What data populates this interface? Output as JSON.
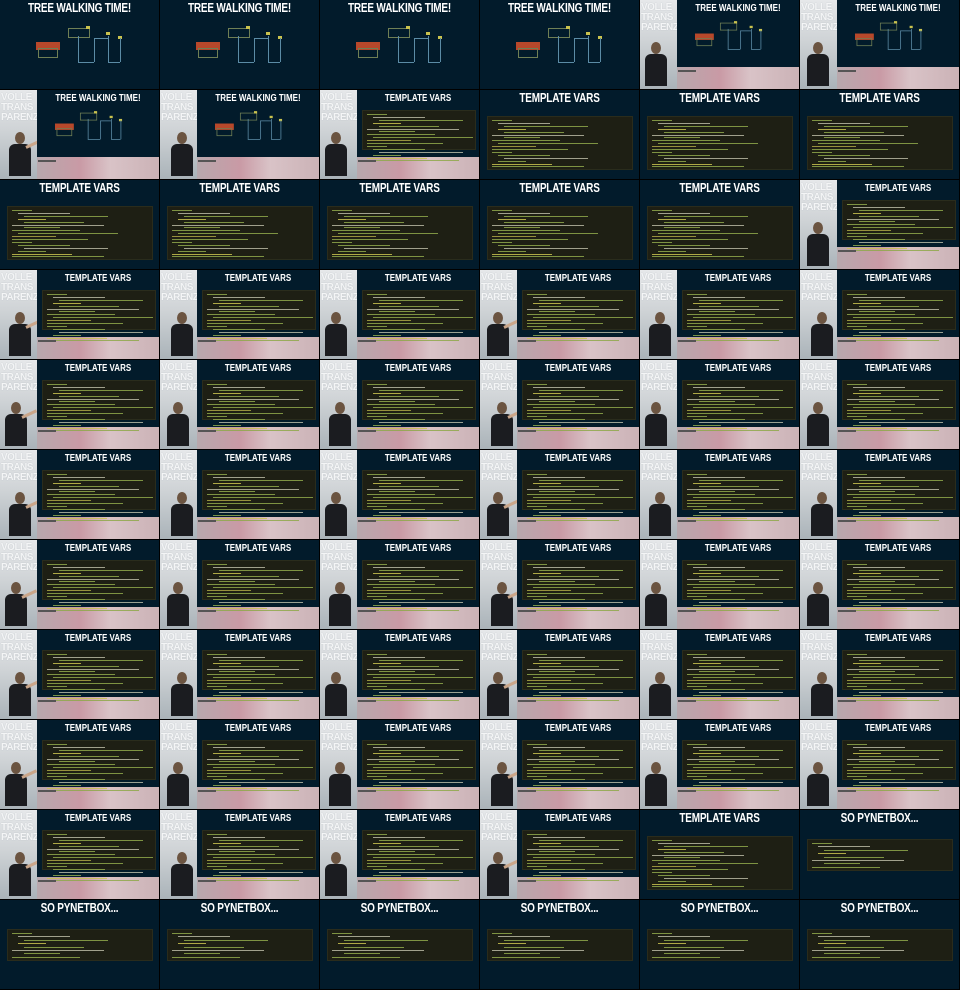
{
  "slides": [
    {
      "layout": "full",
      "kind": "tree",
      "title": "TREE WALKING TIME!"
    },
    {
      "layout": "full",
      "kind": "tree",
      "title": "TREE WALKING TIME!"
    },
    {
      "layout": "full",
      "kind": "tree",
      "title": "TREE WALKING TIME!"
    },
    {
      "layout": "full",
      "kind": "tree",
      "title": "TREE WALKING TIME!"
    },
    {
      "layout": "speaker",
      "kind": "tree",
      "title": "TREE WALKING TIME!",
      "brand": "VOLLE\nTRANS\nPARENZ"
    },
    {
      "layout": "speaker",
      "kind": "tree",
      "title": "TREE WALKING TIME!",
      "brand": "VOLLE\nTRANS\nPARENZ"
    },
    {
      "layout": "speaker",
      "kind": "tree",
      "title": "TREE WALKING TIME!",
      "brand": "VOLLE\nTRANS\nPARENZ"
    },
    {
      "layout": "speaker",
      "kind": "tree",
      "title": "TREE WALKING TIME!",
      "brand": "VOLLE\nTRANS\nPARENZ"
    },
    {
      "layout": "speaker",
      "kind": "template",
      "title": "TEMPLATE VARS",
      "brand": "VOLLE\nTRANS\nPARENZ"
    },
    {
      "layout": "full",
      "kind": "template",
      "title": "TEMPLATE VARS"
    },
    {
      "layout": "full",
      "kind": "template",
      "title": "TEMPLATE VARS"
    },
    {
      "layout": "full",
      "kind": "template",
      "title": "TEMPLATE VARS"
    },
    {
      "layout": "full",
      "kind": "template",
      "title": "TEMPLATE VARS"
    },
    {
      "layout": "full",
      "kind": "template",
      "title": "TEMPLATE VARS"
    },
    {
      "layout": "full",
      "kind": "template",
      "title": "TEMPLATE VARS"
    },
    {
      "layout": "full",
      "kind": "template",
      "title": "TEMPLATE VARS"
    },
    {
      "layout": "full",
      "kind": "template",
      "title": "TEMPLATE VARS"
    },
    {
      "layout": "speaker",
      "kind": "template",
      "title": "TEMPLATE VARS",
      "brand": "VOLLE\nTRANS\nPARENZ"
    },
    {
      "layout": "speaker",
      "kind": "template",
      "title": "TEMPLATE VARS",
      "brand": "VOLLE\nTRANS\nPARENZ"
    },
    {
      "layout": "speaker",
      "kind": "template",
      "title": "TEMPLATE VARS",
      "brand": "VOLLE\nTRANS\nPARENZ"
    },
    {
      "layout": "speaker",
      "kind": "template",
      "title": "TEMPLATE VARS",
      "brand": "VOLLE\nTRANS\nPARENZ"
    },
    {
      "layout": "speaker",
      "kind": "template",
      "title": "TEMPLATE VARS",
      "brand": "VOLLE\nTRANS\nPARENZ"
    },
    {
      "layout": "speaker",
      "kind": "template",
      "title": "TEMPLATE VARS",
      "brand": "VOLLE\nTRANS\nPARENZ"
    },
    {
      "layout": "speaker",
      "kind": "template",
      "title": "TEMPLATE VARS",
      "brand": "VOLLE\nTRANS\nPARENZ"
    },
    {
      "layout": "speaker",
      "kind": "template",
      "title": "TEMPLATE VARS",
      "brand": "VOLLE\nTRANS\nPARENZ"
    },
    {
      "layout": "speaker",
      "kind": "template",
      "title": "TEMPLATE VARS",
      "brand": "VOLLE\nTRANS\nPARENZ"
    },
    {
      "layout": "speaker",
      "kind": "template",
      "title": "TEMPLATE VARS",
      "brand": "VOLLE\nTRANS\nPARENZ"
    },
    {
      "layout": "speaker",
      "kind": "template",
      "title": "TEMPLATE VARS",
      "brand": "VOLLE\nTRANS\nPARENZ"
    },
    {
      "layout": "speaker",
      "kind": "template",
      "title": "TEMPLATE VARS",
      "brand": "VOLLE\nTRANS\nPARENZ"
    },
    {
      "layout": "speaker",
      "kind": "template",
      "title": "TEMPLATE VARS",
      "brand": "VOLLE\nTRANS\nPARENZ"
    },
    {
      "layout": "speaker",
      "kind": "template",
      "title": "TEMPLATE VARS",
      "brand": "VOLLE\nTRANS\nPARENZ"
    },
    {
      "layout": "speaker",
      "kind": "template",
      "title": "TEMPLATE VARS",
      "brand": "VOLLE\nTRANS\nPARENZ"
    },
    {
      "layout": "speaker",
      "kind": "template",
      "title": "TEMPLATE VARS",
      "brand": "VOLLE\nTRANS\nPARENZ"
    },
    {
      "layout": "speaker",
      "kind": "template",
      "title": "TEMPLATE VARS",
      "brand": "VOLLE\nTRANS\nPARENZ"
    },
    {
      "layout": "speaker",
      "kind": "template",
      "title": "TEMPLATE VARS",
      "brand": "VOLLE\nTRANS\nPARENZ"
    },
    {
      "layout": "speaker",
      "kind": "template",
      "title": "TEMPLATE VARS",
      "brand": "VOLLE\nTRANS\nPARENZ"
    },
    {
      "layout": "speaker",
      "kind": "template",
      "title": "TEMPLATE VARS",
      "brand": "VOLLE\nTRANS\nPARENZ"
    },
    {
      "layout": "speaker",
      "kind": "template",
      "title": "TEMPLATE VARS",
      "brand": "VOLLE\nTRANS\nPARENZ"
    },
    {
      "layout": "speaker",
      "kind": "template",
      "title": "TEMPLATE VARS",
      "brand": "VOLLE\nTRANS\nPARENZ"
    },
    {
      "layout": "speaker",
      "kind": "template",
      "title": "TEMPLATE VARS",
      "brand": "VOLLE\nTRANS\nPARENZ"
    },
    {
      "layout": "speaker",
      "kind": "template",
      "title": "TEMPLATE VARS",
      "brand": "VOLLE\nTRANS\nPARENZ"
    },
    {
      "layout": "speaker",
      "kind": "template",
      "title": "TEMPLATE VARS",
      "brand": "VOLLE\nTRANS\nPARENZ"
    },
    {
      "layout": "speaker",
      "kind": "template",
      "title": "TEMPLATE VARS",
      "brand": "VOLLE\nTRANS\nPARENZ"
    },
    {
      "layout": "speaker",
      "kind": "template",
      "title": "TEMPLATE VARS",
      "brand": "VOLLE\nTRANS\nPARENZ"
    },
    {
      "layout": "speaker",
      "kind": "template",
      "title": "TEMPLATE VARS",
      "brand": "VOLLE\nTRANS\nPARENZ"
    },
    {
      "layout": "speaker",
      "kind": "template",
      "title": "TEMPLATE VARS",
      "brand": "VOLLE\nTRANS\nPARENZ"
    },
    {
      "layout": "speaker",
      "kind": "template",
      "title": "TEMPLATE VARS",
      "brand": "VOLLE\nTRANS\nPARENZ"
    },
    {
      "layout": "speaker",
      "kind": "template",
      "title": "TEMPLATE VARS",
      "brand": "VOLLE\nTRANS\nPARENZ"
    },
    {
      "layout": "speaker",
      "kind": "template",
      "title": "TEMPLATE VARS",
      "brand": "VOLLE\nTRANS\nPARENZ"
    },
    {
      "layout": "speaker",
      "kind": "template",
      "title": "TEMPLATE VARS",
      "brand": "VOLLE\nTRANS\nPARENZ"
    },
    {
      "layout": "speaker",
      "kind": "template",
      "title": "TEMPLATE VARS",
      "brand": "VOLLE\nTRANS\nPARENZ"
    },
    {
      "layout": "speaker",
      "kind": "template",
      "title": "TEMPLATE VARS",
      "brand": "VOLLE\nTRANS\nPARENZ"
    },
    {
      "layout": "speaker",
      "kind": "template",
      "title": "TEMPLATE VARS",
      "brand": "VOLLE\nTRANS\nPARENZ"
    },
    {
      "layout": "speaker",
      "kind": "template",
      "title": "TEMPLATE VARS",
      "brand": "VOLLE\nTRANS\nPARENZ"
    },
    {
      "layout": "speaker",
      "kind": "template",
      "title": "TEMPLATE VARS",
      "brand": "VOLLE\nTRANS\nPARENZ"
    },
    {
      "layout": "speaker",
      "kind": "template",
      "title": "TEMPLATE VARS",
      "brand": "VOLLE\nTRANS\nPARENZ"
    },
    {
      "layout": "speaker",
      "kind": "template",
      "title": "TEMPLATE VARS",
      "brand": "VOLLE\nTRANS\nPARENZ"
    },
    {
      "layout": "speaker",
      "kind": "template",
      "title": "TEMPLATE VARS",
      "brand": "VOLLE\nTRANS\nPARENZ"
    },
    {
      "layout": "full",
      "kind": "template",
      "title": "TEMPLATE VARS"
    },
    {
      "layout": "full",
      "kind": "pynet",
      "title": "SO PYNETBOX..."
    },
    {
      "layout": "full",
      "kind": "pynet",
      "title": "SO PYNETBOX..."
    },
    {
      "layout": "full",
      "kind": "pynet",
      "title": "SO PYNETBOX..."
    },
    {
      "layout": "full",
      "kind": "pynet",
      "title": "SO PYNETBOX..."
    },
    {
      "layout": "full",
      "kind": "pynet",
      "title": "SO PYNETBOX..."
    },
    {
      "layout": "full",
      "kind": "pynet",
      "title": "SO PYNETBOX..."
    },
    {
      "layout": "full",
      "kind": "pynet",
      "title": "SO PYNETBOX..."
    }
  ]
}
